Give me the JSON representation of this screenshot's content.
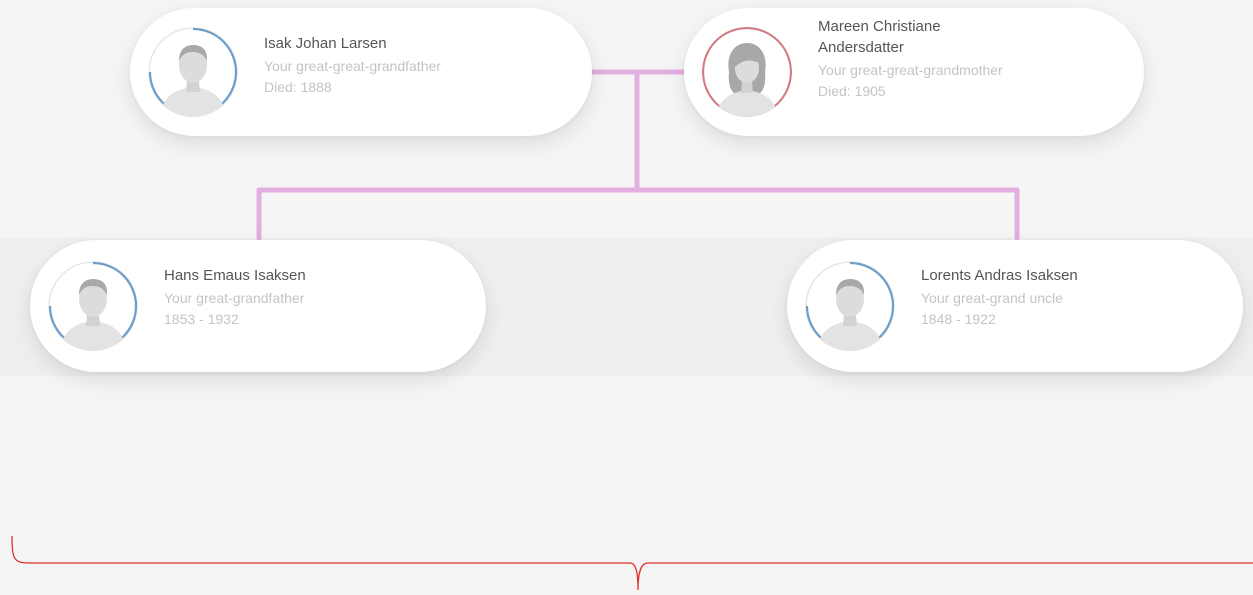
{
  "colors": {
    "connector": "#e3aee0",
    "male_ring": "#6e9ec9",
    "female_ring": "#d27a84",
    "bracket": "#e0312b"
  },
  "persons": {
    "isak": {
      "name": "Isak Johan Larsen",
      "relation": "Your great-great-grandfather",
      "dates": "Died: 1888",
      "gender": "male",
      "avatar_icon": "male-silhouette-icon"
    },
    "mareen": {
      "name": "Mareen Christiane Andersdatter",
      "relation": "Your great-great-grandmother",
      "dates": "Died: 1905",
      "gender": "female",
      "avatar_icon": "female-silhouette-icon"
    },
    "hans": {
      "name": "Hans Emaus Isaksen",
      "relation": "Your great-grandfather",
      "dates": "1853 - 1932",
      "gender": "male",
      "avatar_icon": "male-silhouette-icon"
    },
    "lorents": {
      "name": "Lorents Andras Isaksen",
      "relation": "Your great-grand uncle",
      "dates": "1848 - 1922",
      "gender": "male",
      "avatar_icon": "male-silhouette-icon"
    }
  }
}
